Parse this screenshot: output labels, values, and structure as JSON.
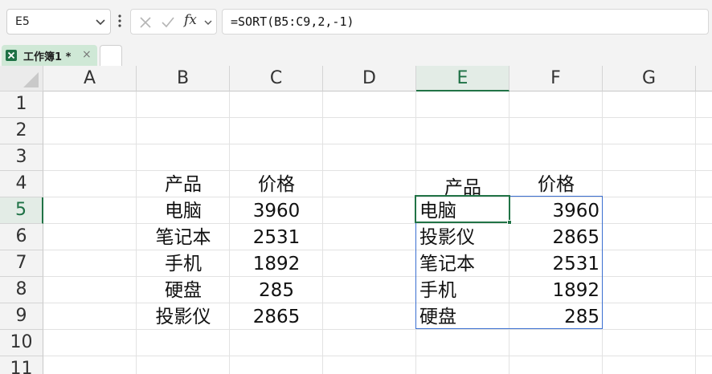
{
  "formula_bar": {
    "name_box": "E5",
    "fx_label": "fx",
    "formula": "=SORT(B5:C9,2,-1)"
  },
  "tabs": {
    "workbook_label": "工作簿1 *",
    "close_glyph": "×"
  },
  "sheet": {
    "columns": [
      "A",
      "B",
      "C",
      "D",
      "E",
      "F",
      "G"
    ],
    "rows": [
      "1",
      "2",
      "3",
      "4",
      "5",
      "6",
      "7",
      "8",
      "9",
      "10",
      "11"
    ],
    "selected_column": "E",
    "selected_row": "5",
    "source_table": {
      "headers": [
        "产品",
        "价格"
      ],
      "rows": [
        [
          "电脑",
          "3960"
        ],
        [
          "笔记本",
          "2531"
        ],
        [
          "手机",
          "1892"
        ],
        [
          "硬盘",
          "285"
        ],
        [
          "投影仪",
          "2865"
        ]
      ]
    },
    "sorted_table": {
      "headers": [
        "产品",
        "价格"
      ],
      "rows": [
        [
          "电脑",
          "3960"
        ],
        [
          "投影仪",
          "2865"
        ],
        [
          "笔记本",
          "2531"
        ],
        [
          "手机",
          "1892"
        ],
        [
          "硬盘",
          "285"
        ]
      ]
    }
  },
  "colors": {
    "accent_green": "#217346",
    "spill_border": "#3b6fd1",
    "tab_bg": "#cfe8d6"
  },
  "icons": [
    "chevron-down-icon",
    "more-vertical-icon",
    "cancel-icon",
    "check-icon",
    "excel-file-icon",
    "close-icon"
  ]
}
